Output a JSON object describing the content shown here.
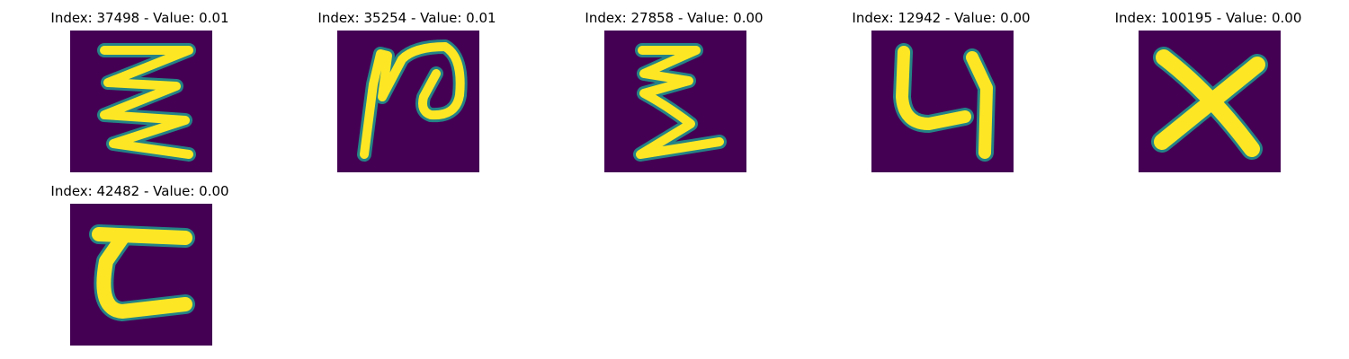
{
  "colors": {
    "background": "#440154",
    "stroke_core": "#fde725",
    "stroke_edge": "#21918c"
  },
  "panels": [
    {
      "title": "Index: 37498 - Value: 0.01"
    },
    {
      "title": "Index: 35254 - Value: 0.01"
    },
    {
      "title": "Index: 27858 - Value: 0.00"
    },
    {
      "title": "Index: 12942 - Value: 0.00"
    },
    {
      "title": "Index: 100195 - Value: 0.00"
    },
    {
      "title": "Index: 42482 - Value: 0.00"
    }
  ]
}
